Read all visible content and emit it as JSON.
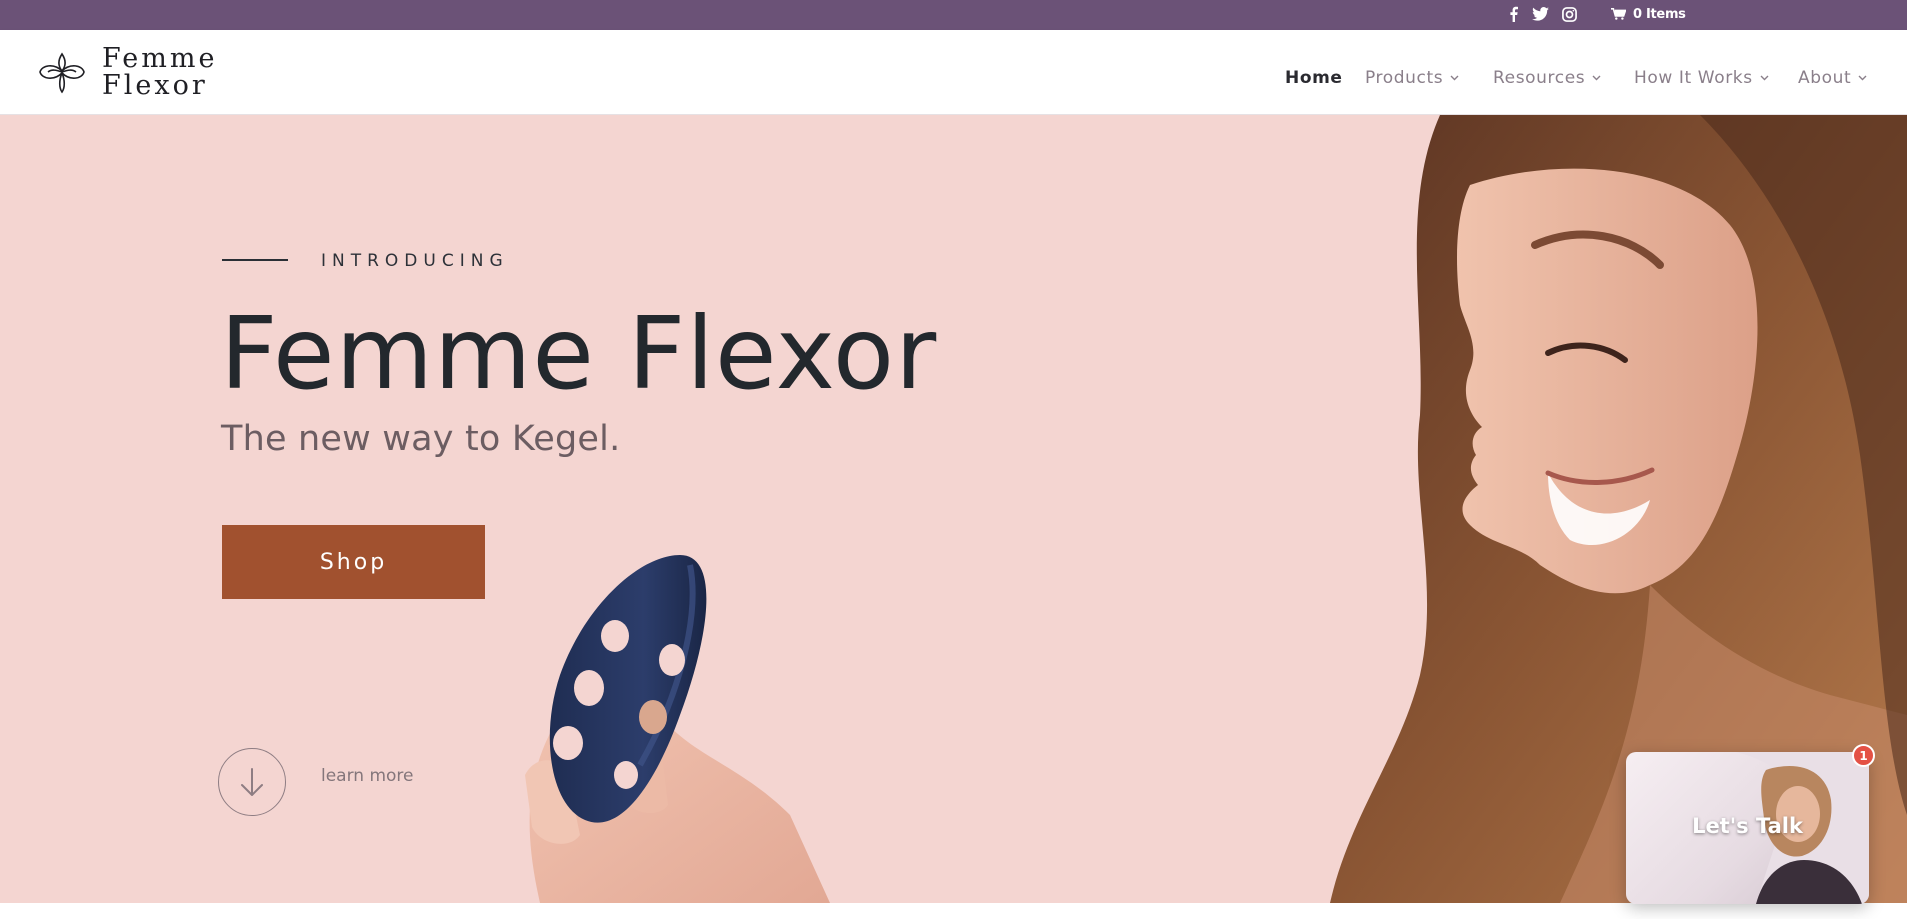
{
  "topbar": {
    "cart_label": "0 Items",
    "social": [
      "facebook-icon",
      "twitter-icon",
      "instagram-icon"
    ]
  },
  "brand": {
    "logo_line1": "Femme",
    "logo_line2": "Flexor"
  },
  "nav": {
    "items": [
      {
        "label": "Home",
        "active": true,
        "dropdown": false
      },
      {
        "label": "Products",
        "active": false,
        "dropdown": true
      },
      {
        "label": "Resources",
        "active": false,
        "dropdown": true
      },
      {
        "label": "How It Works",
        "active": false,
        "dropdown": true
      },
      {
        "label": "About",
        "active": false,
        "dropdown": true
      }
    ]
  },
  "hero": {
    "eyebrow": "INTRODUCING",
    "title": "Femme Flexor",
    "subtitle": "The new way to Kegel.",
    "cta_label": "Shop",
    "learn_more": "learn more"
  },
  "chat_widget": {
    "label": "Let's Talk",
    "badge_count": "1"
  },
  "colors": {
    "topbar": "#6b5277",
    "hero_bg": "#f4d5d1",
    "cta": "#a1512f",
    "title_text": "#23282d",
    "badge": "#e45145"
  }
}
